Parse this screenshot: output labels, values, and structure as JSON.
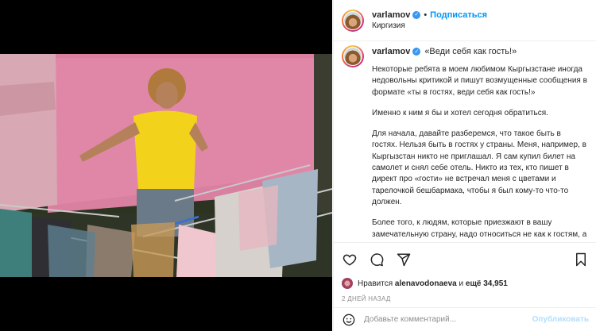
{
  "post": {
    "username": "varlamov",
    "follow_label": "Подписаться",
    "dot": "•",
    "location": "Киргизия",
    "verified_mark": "✓",
    "caption_title": "«Веди себя как гость!»",
    "paragraphs": [
      "Некоторые ребята в моем любимом Кыргызстане иногда недовольны критикой и пишут возмущенные сообщения в формате «ты в гостях, веди себя как гость!»",
      "Именно к ним я бы и хотел сегодня обратиться.",
      "Для начала, давайте разберемся, что такое быть в гостях. Нельзя быть в гостях у страны. Меня, например, в Кыргызстан никто не приглашал. Я сам купил билет на самолет и снял себе отель. Никто из тех, кто пишет в директ про «гости» не встречал меня с цветами и тарелочкой бешбармака, чтобы я был кому-то что-то должен.",
      "Более того, к людям, которые приезжают в вашу замечательную страну, надо относиться не как к гостям, а как к клиентам. Они, в конце концов, приезжают тратить деньги и пользоваться вашими услугами. А клиент всегда прав."
    ],
    "likes": {
      "prefix": "Нравится",
      "user": "alenavodonaeva",
      "middle": "и",
      "count": "ещё 34,951"
    },
    "time": "2 ДНЕЙ НАЗАД",
    "comment_placeholder": "Добавьте комментарий...",
    "post_label": "Опубликовать"
  },
  "icons": [
    "heart-icon",
    "comment-icon",
    "share-icon",
    "bookmark-icon",
    "emoji-icon"
  ],
  "colors": {
    "accent": "#0095f6",
    "post_disabled": "#b2dffc",
    "verified": "#3897f0"
  }
}
